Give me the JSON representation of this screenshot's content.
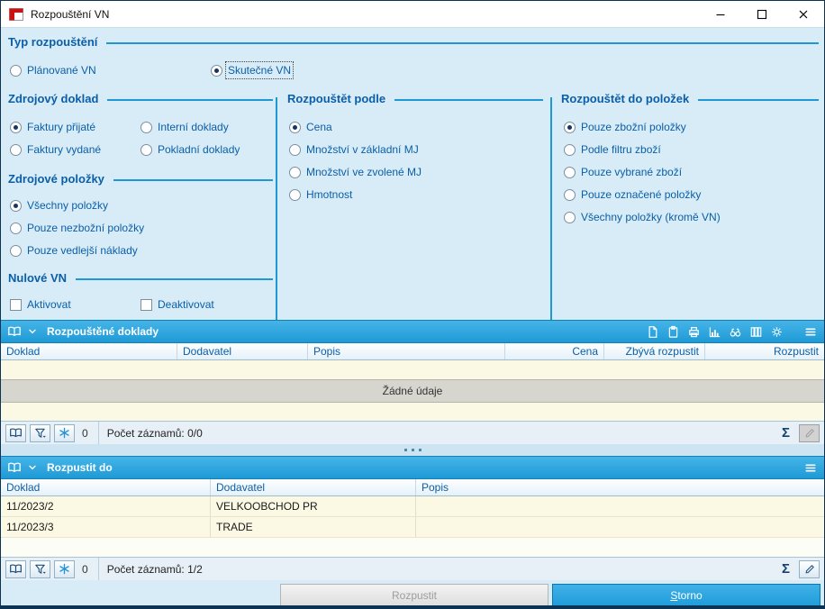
{
  "colors": {
    "window_background": "#d7ecf7",
    "accent_text_blue": "#0b5ea8",
    "rule_blue": "#1e97d5",
    "grid_header_blue": "#2fa6df",
    "row_yellow": "#fbf8e3",
    "no_data_gray": "#d7d6ce",
    "primary_button_blue": "#2aa3de",
    "window_border": "#0d3354"
  },
  "window": {
    "title": "Rozpouštění VN"
  },
  "form": {
    "type": {
      "heading": "Typ rozpouštění",
      "options": [
        {
          "label": "Plánované VN",
          "selected": false
        },
        {
          "label": "Skutečné VN",
          "selected": true
        }
      ]
    },
    "source_doc": {
      "heading": "Zdrojový doklad",
      "options": [
        {
          "label": "Faktury přijaté",
          "selected": true
        },
        {
          "label": "Interní doklady",
          "selected": false
        },
        {
          "label": "Faktury vydané",
          "selected": false
        },
        {
          "label": "Pokladní doklady",
          "selected": false
        }
      ]
    },
    "source_items": {
      "heading": "Zdrojové položky",
      "options": [
        {
          "label": "Všechny položky",
          "selected": true
        },
        {
          "label": "Pouze nezbožní položky",
          "selected": false
        },
        {
          "label": "Pouze vedlejší náklady",
          "selected": false
        }
      ]
    },
    "zero_vn": {
      "heading": "Nulové VN",
      "options": [
        {
          "label": "Aktivovat",
          "selected": false
        },
        {
          "label": "Deaktivovat",
          "selected": false
        }
      ]
    },
    "dissolve_by": {
      "heading": "Rozpouštět podle",
      "options": [
        {
          "label": "Cena",
          "selected": true
        },
        {
          "label": "Množství v základní MJ",
          "selected": false
        },
        {
          "label": "Množství ve zvolené MJ",
          "selected": false
        },
        {
          "label": "Hmotnost",
          "selected": false
        }
      ]
    },
    "dissolve_into": {
      "heading": "Rozpouštět do položek",
      "options": [
        {
          "label": "Pouze zbožní položky",
          "selected": true
        },
        {
          "label": "Podle filtru zboží",
          "selected": false
        },
        {
          "label": "Pouze vybrané zboží",
          "selected": false
        },
        {
          "label": "Pouze označené položky",
          "selected": false
        },
        {
          "label": "Všechny položky (kromě VN)",
          "selected": false
        }
      ]
    }
  },
  "grid1": {
    "title": "Rozpouštěné doklady",
    "columns": [
      "Doklad",
      "Dodavatel",
      "Popis",
      "Cena",
      "Zbývá rozpustit",
      "Rozpustit"
    ],
    "empty_text": "Žádné údaje",
    "toolbar_icons": [
      "book",
      "chevron-down",
      "new-document",
      "clipboard",
      "print",
      "chart",
      "search",
      "columns",
      "settings",
      "menu"
    ],
    "footer": {
      "frozen_count": "0",
      "record_count": "Počet záznamů: 0/0",
      "sum_symbol": "Σ"
    }
  },
  "grid2": {
    "title": "Rozpustit do",
    "columns": [
      "Doklad",
      "Dodavatel",
      "Popis"
    ],
    "rows": [
      {
        "doklad": "11/2023/2",
        "dodavatel": "VELKOOBCHOD PR",
        "popis": ""
      },
      {
        "doklad": "11/2023/3",
        "dodavatel": "TRADE",
        "popis": ""
      }
    ],
    "toolbar_icons": [
      "book",
      "chevron-down",
      "menu"
    ],
    "footer": {
      "frozen_count": "0",
      "record_count": "Počet záznamů: 1/2",
      "sum_symbol": "Σ"
    }
  },
  "buttons": {
    "dissolve": "Rozpustit",
    "dissolve_enabled": false,
    "cancel": "Storno"
  }
}
